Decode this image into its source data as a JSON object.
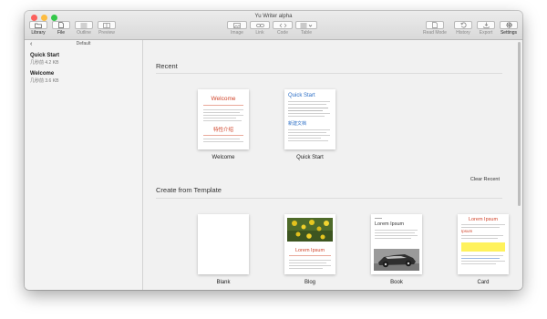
{
  "window": {
    "title": "Yu Writer alpha"
  },
  "toolbar": {
    "library": "Library",
    "file": "File",
    "outline": "Outline",
    "preview": "Preview",
    "image": "Image",
    "link": "Link",
    "code": "Code",
    "table": "Table",
    "read_mode": "Read Mode",
    "history": "History",
    "export": "Export",
    "settings": "Settings"
  },
  "sidebar": {
    "back_glyph": "‹",
    "title": "Default",
    "items": [
      {
        "name": "Quick Start",
        "meta": "几秒前    4.2 KB"
      },
      {
        "name": "Welcome",
        "meta": "几秒前    3.6 KB"
      }
    ]
  },
  "main": {
    "recent_title": "Recent",
    "recent": [
      {
        "label": "Welcome",
        "heading": "Welcome",
        "subheading": "特性介绍"
      },
      {
        "label": "Quick Start",
        "heading": "Quick Start",
        "subheading": "新建文档"
      }
    ],
    "clear_recent": "Clear Recent",
    "template_title": "Create from Template",
    "templates": [
      {
        "label": "Blank"
      },
      {
        "label": "Blog",
        "heading": "Lorem Ipsum"
      },
      {
        "label": "Book",
        "heading": "Lorem Ipsum"
      },
      {
        "label": "Card",
        "heading": "Lorem Ipsum",
        "subheading": "Ipsum"
      }
    ]
  },
  "colors": {
    "close": "#fc605c",
    "minimize": "#fdbc40",
    "zoom": "#34c84a",
    "accent_red": "#d0442a",
    "accent_blue": "#2d6fc6",
    "highlight": "#fff25c"
  }
}
